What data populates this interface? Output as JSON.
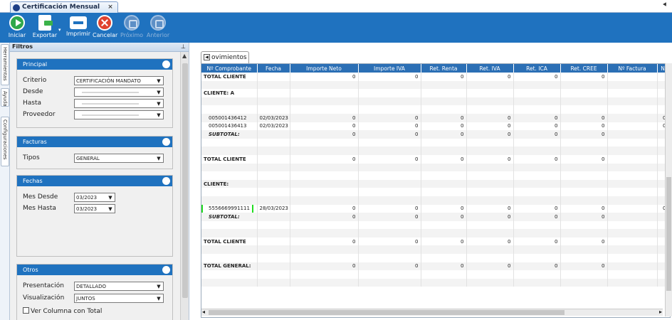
{
  "window": {
    "tab_title": "Certificación Mensual",
    "close_icon": "×",
    "pin_icon": "⯇"
  },
  "toolbar": {
    "iniciar": "Iniciar",
    "exportar": "Exportar",
    "imprimir": "Imprimir",
    "cancelar": "Cancelar",
    "proximo": "Próximo",
    "anterior": "Anterior",
    "colors": {
      "bar": "#1f72bf",
      "play": "#2fa84a",
      "cancel": "#e0432f"
    }
  },
  "side_tabs": {
    "herramientas": "Herramientas",
    "ayuda": "Ayuda",
    "configuraciones": "Configuraciones"
  },
  "filters": {
    "title": "Filtros",
    "principal": {
      "title": "Principal",
      "criterio_label": "Criterio",
      "criterio_value": "CERTIFICACIÓN MANDATO",
      "desde_label": "Desde",
      "hasta_label": "Hasta",
      "proveedor_label": "Proveedor"
    },
    "facturas": {
      "title": "Facturas",
      "tipos_label": "Tipos",
      "tipos_value": "GENERAL"
    },
    "fechas": {
      "title": "Fechas",
      "mes_desde_label": "Mes Desde",
      "mes_desde_value": "03/2023",
      "mes_hasta_label": "Mes Hasta",
      "mes_hasta_value": "03/2023"
    },
    "otros": {
      "title": "Otros",
      "presentacion_label": "Presentación",
      "presentacion_value": "DETALLADO",
      "visualizacion_label": "Visualización",
      "visualizacion_value": "JUNTOS",
      "ver_columna_label": "Ver Columna con Total"
    }
  },
  "results": {
    "tab_label": "ovimientos",
    "columns": [
      "Nº Comprobante",
      "Fecha",
      "Importe Neto",
      "Importe IVA",
      "Ret. Renta",
      "Ret. IVA",
      "Ret. ICA",
      "Ret. CREE",
      "Nº Factura",
      "N"
    ],
    "rows": [
      {
        "c": [
          "TOTAL CLIENTE",
          "",
          "0",
          "0",
          "0",
          "0",
          "0",
          "0",
          "",
          ""
        ],
        "style": "bold"
      },
      {
        "c": [
          "",
          "",
          "",
          "",
          "",
          "",
          "",
          "",
          "",
          ""
        ]
      },
      {
        "c": [
          "CLIENTE: A",
          "",
          "",
          "",
          "",
          "",
          "",
          "",
          "",
          ""
        ],
        "style": "bold"
      },
      {
        "c": [
          "",
          "",
          "",
          "",
          "",
          "",
          "",
          "",
          "",
          ""
        ]
      },
      {
        "c": [
          "",
          "",
          "",
          "",
          "",
          "",
          "",
          "",
          "",
          ""
        ]
      },
      {
        "c": [
          "005001436412",
          "02/03/2023",
          "0",
          "0",
          "0",
          "0",
          "0",
          "0",
          "",
          "0"
        ],
        "indent": true
      },
      {
        "c": [
          "005001436413",
          "02/03/2023",
          "0",
          "0",
          "0",
          "0",
          "0",
          "0",
          "",
          "0"
        ],
        "indent": true
      },
      {
        "c": [
          "SUBTOTAL:",
          "",
          "0",
          "0",
          "0",
          "0",
          "0",
          "0",
          "",
          ""
        ],
        "style": "it",
        "indent": true
      },
      {
        "c": [
          "",
          "",
          "",
          "",
          "",
          "",
          "",
          "",
          "",
          ""
        ]
      },
      {
        "c": [
          "",
          "",
          "",
          "",
          "",
          "",
          "",
          "",
          "",
          ""
        ]
      },
      {
        "c": [
          "TOTAL CLIENTE",
          "",
          "0",
          "0",
          "0",
          "0",
          "0",
          "0",
          "",
          ""
        ],
        "style": "bold"
      },
      {
        "c": [
          "",
          "",
          "",
          "",
          "",
          "",
          "",
          "",
          "",
          ""
        ]
      },
      {
        "c": [
          "",
          "",
          "",
          "",
          "",
          "",
          "",
          "",
          "",
          ""
        ]
      },
      {
        "c": [
          "CLIENTE:",
          "",
          "",
          "",
          "",
          "",
          "",
          "",
          "",
          ""
        ],
        "style": "bold"
      },
      {
        "c": [
          "",
          "",
          "",
          "",
          "",
          "",
          "",
          "",
          "",
          ""
        ]
      },
      {
        "c": [
          "",
          "",
          "",
          "",
          "",
          "",
          "",
          "",
          "",
          ""
        ]
      },
      {
        "c": [
          "5556669991111",
          "28/03/2023",
          "0",
          "0",
          "0",
          "0",
          "0",
          "0",
          "",
          "0"
        ],
        "indent": true,
        "highlight": true
      },
      {
        "c": [
          "SUBTOTAL:",
          "",
          "0",
          "0",
          "0",
          "0",
          "0",
          "0",
          "",
          ""
        ],
        "style": "it",
        "indent": true
      },
      {
        "c": [
          "",
          "",
          "",
          "",
          "",
          "",
          "",
          "",
          "",
          ""
        ]
      },
      {
        "c": [
          "",
          "",
          "",
          "",
          "",
          "",
          "",
          "",
          "",
          ""
        ]
      },
      {
        "c": [
          "TOTAL CLIENTE",
          "",
          "0",
          "0",
          "0",
          "0",
          "0",
          "0",
          "",
          ""
        ],
        "style": "bold"
      },
      {
        "c": [
          "",
          "",
          "",
          "",
          "",
          "",
          "",
          "",
          "",
          ""
        ]
      },
      {
        "c": [
          "",
          "",
          "",
          "",
          "",
          "",
          "",
          "",
          "",
          ""
        ]
      },
      {
        "c": [
          "TOTAL GENERAL:",
          "",
          "0",
          "0",
          "0",
          "0",
          "0",
          "0",
          "",
          ""
        ],
        "style": "bold"
      },
      {
        "c": [
          "",
          "",
          "",
          "",
          "",
          "",
          "",
          "",
          "",
          ""
        ]
      },
      {
        "c": [
          "",
          "",
          "",
          "",
          "",
          "",
          "",
          "",
          "",
          ""
        ]
      }
    ]
  }
}
